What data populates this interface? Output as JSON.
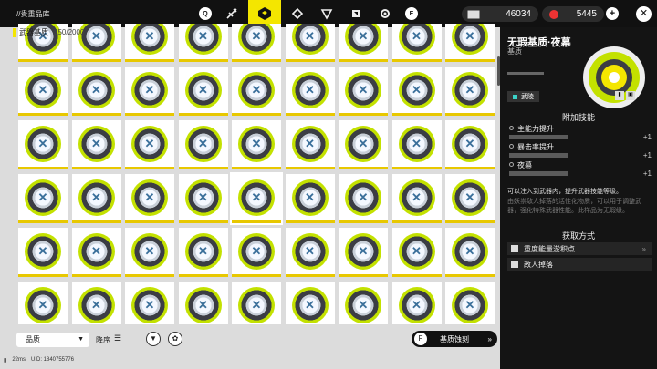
{
  "topbar": {
    "breadcrumb": "//贵重品库",
    "q_key": "Q",
    "e_key": "E",
    "nav_icons": [
      "weapon-tab-icon",
      "material-box-icon",
      "tag-icon",
      "triangle-icon",
      "gear-piece-icon",
      "settings-gear-icon"
    ],
    "currency1": "46034",
    "currency2": "5445",
    "add_label": "+",
    "close_label": "✕"
  },
  "category": {
    "name": "武器基质",
    "count": "350/2000"
  },
  "grid": {
    "item_name": "无瑕基质·夜幕",
    "tiles": 54
  },
  "bottom": {
    "quality_label": "品质",
    "sort_label": "降序",
    "engrave_label": "基质蚀刻",
    "engrave_key": "F"
  },
  "footer": {
    "ping": "22ms",
    "uid": "UID: 1840755776"
  },
  "panel": {
    "title": "无瑕基质·夜幕",
    "type": "基质",
    "tag": "武陵",
    "skills_header": "附加技能",
    "skills": [
      {
        "name": "主能力提升",
        "plus": "+1"
      },
      {
        "name": "暴击率提升",
        "plus": "+1"
      },
      {
        "name": "夜幕",
        "plus": "+1"
      }
    ],
    "desc1": "可以注入到武器内，提升武器技能等级。",
    "desc2": "由妖祟敌人掉落的活性化物质，可以用于调整武器，强化特殊武器性能。此样品为无瑕级。",
    "acquire_header": "获取方式",
    "acquire": [
      {
        "label": "重度能量淤积点"
      },
      {
        "label": "敌人掉落"
      }
    ]
  },
  "colors": {
    "accent": "#f4e600",
    "panel_bg": "#141414"
  }
}
